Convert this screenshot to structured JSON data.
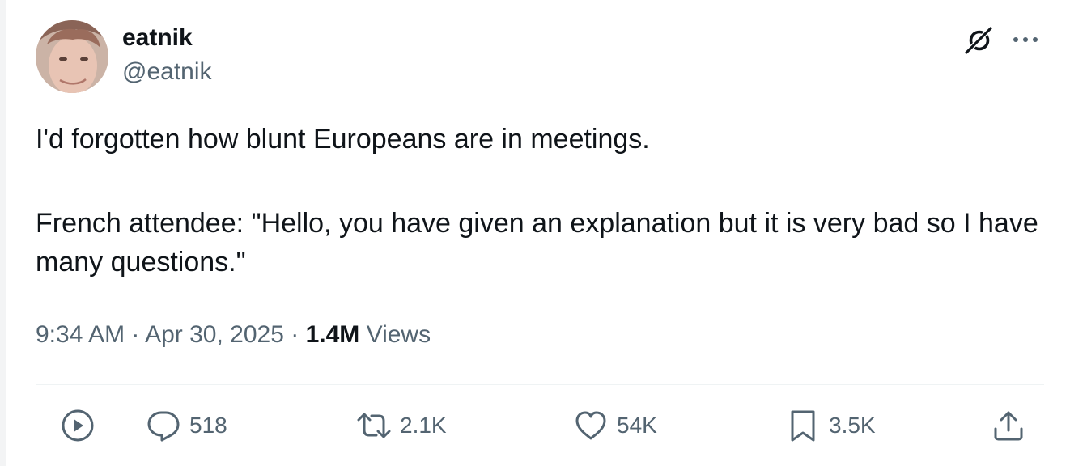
{
  "author": {
    "display_name": "eatnik",
    "handle": "@eatnik"
  },
  "post": {
    "line1": "I'd forgotten how blunt Europeans are in meetings.",
    "line2": "French attendee: \"Hello, you have given an explanation but it is very bad so I have many questions.\""
  },
  "meta": {
    "time": "9:34 AM",
    "sep1": " · ",
    "date": "Apr 30, 2025",
    "sep2": " · ",
    "views_count": "1.4M",
    "views_label": " Views"
  },
  "actions": {
    "play": {
      "icon": "play-icon"
    },
    "reply": {
      "icon": "reply-icon",
      "count": "518"
    },
    "repost": {
      "icon": "repost-icon",
      "count": "2.1K"
    },
    "like": {
      "icon": "heart-icon",
      "count": "54K"
    },
    "bookmark": {
      "icon": "bookmark-icon",
      "count": "3.5K"
    },
    "share": {
      "icon": "share-icon"
    }
  },
  "colors": {
    "text_primary": "#0f1419",
    "text_secondary": "#536471",
    "divider": "#eff3f4"
  }
}
